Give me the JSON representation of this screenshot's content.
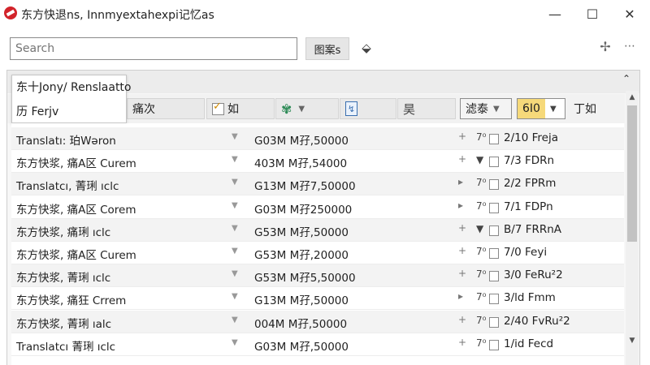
{
  "window": {
    "title": "东方快退ns, Innmyextahexpi记忆as",
    "controls": {
      "minimize": "—",
      "maximize": "☐",
      "close": "✕"
    }
  },
  "search": {
    "placeholder": "Search",
    "value": ""
  },
  "toolbar_top": {
    "filter_label": "图案s",
    "tag_icon": "tag-icon",
    "pin_icon": "pin-icon",
    "more_icon": "more-icon"
  },
  "panel": {
    "mode_title": "东十Jony/ Renslaatto",
    "mode_sub": "历 Ferjv",
    "collapse_icon": "chevron-up-icon"
  },
  "toolbar": {
    "priority_label": "痛次",
    "check_label": "如",
    "color_icon": "flower-icon",
    "doc_icon": "document-icon",
    "page_label": "昊",
    "sort_label": "滤泰",
    "count_value": "6I0",
    "move_label": "丁如"
  },
  "rows": [
    {
      "name": "Translatı: 珀Wəron",
      "size": "G03M  M孖,50000",
      "action": "+",
      "sep": "7⁰",
      "status": "2/10 Freja"
    },
    {
      "name": "东方快浆, 痛A区 Curem",
      "size": "403M  M孖,54000",
      "action": "+",
      "sep": "▼",
      "status": "7/3 FDRn"
    },
    {
      "name": "Translatcı, 菁琍 ıclc",
      "size": "G13M  M孖7,50000",
      "action": "▸",
      "sep": "7⁰",
      "status": "2/2 FPRm"
    },
    {
      "name": "东方快浆, 痛A区 Corem",
      "size": "G03M  M孖250000",
      "action": "▸",
      "sep": "7⁰",
      "status": "7/1 FDPn"
    },
    {
      "name": "东方快浆, 痛琍 ıclc",
      "size": "G53M  M孖,50000",
      "action": "+",
      "sep": "▼",
      "status": "B/7 FRRnA"
    },
    {
      "name": "东方快浆, 痛A区 Curem",
      "size": "G53M  M孖,20000",
      "action": "+",
      "sep": "7⁰",
      "status": "7/0 Feyi"
    },
    {
      "name": "东方快浆, 菁琍 ıclc",
      "size": "G53M  M孖5,50000",
      "action": "+",
      "sep": "7⁰",
      "status": "3/0 FeRu²2"
    },
    {
      "name": "东方快浆, 痛狂 Crrem",
      "size": "G13M  M孖,50000",
      "action": "▸",
      "sep": "7⁰",
      "status": "3/ld Fmm"
    },
    {
      "name": "东方快浆, 菁琍 ıalc",
      "size": "004M  M孖,50000",
      "action": "+",
      "sep": "7⁰",
      "status": "2/40 FvRu²2"
    },
    {
      "name": "Translatcı 菁琍 ıclc",
      "size": "G03M  M孖,50000",
      "action": "+",
      "sep": "7⁰",
      "status": "1/id Fecd"
    }
  ]
}
